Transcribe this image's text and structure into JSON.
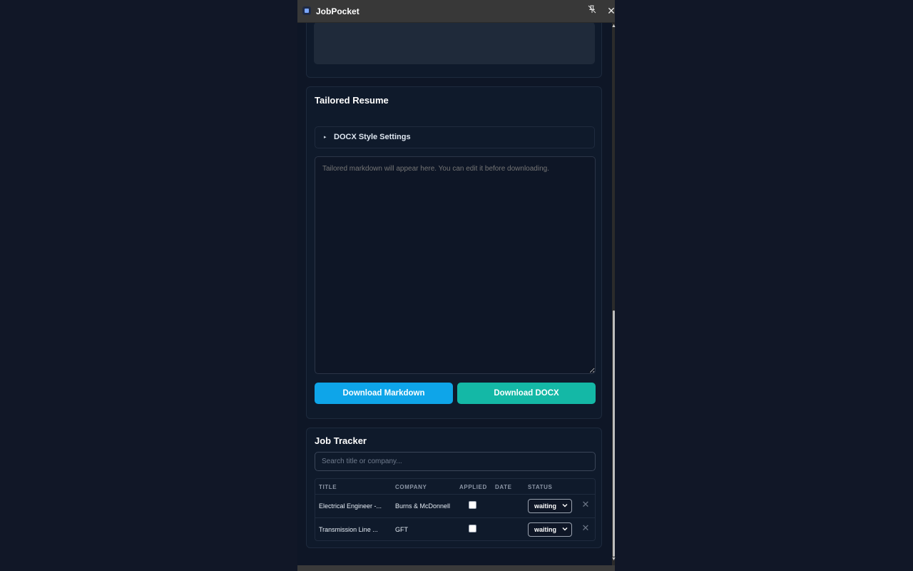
{
  "window": {
    "title": "JobPocket",
    "pin_icon": "pin-off-icon",
    "close_icon": "close-icon",
    "close_glyph": "✕",
    "scroll_up_glyph": "▲",
    "scroll_down_glyph": "▼"
  },
  "resume": {
    "title": "Tailored Resume",
    "docx_settings_label": "DOCX Style Settings",
    "docx_toggle_glyph": "▸",
    "markdown_placeholder": "Tailored markdown will appear here. You can edit it before downloading.",
    "download_markdown": "Download Markdown",
    "download_docx": "Download DOCX"
  },
  "tracker": {
    "title": "Job Tracker",
    "search_placeholder": "Search title or company...",
    "columns": {
      "title": "TITLE",
      "company": "COMPANY",
      "applied": "APPLIED",
      "date": "DATE",
      "status": "STATUS"
    },
    "rows": [
      {
        "title": "Electrical Engineer -...",
        "company": "Burns & McDonnell",
        "applied": false,
        "date": "",
        "status": "waiting"
      },
      {
        "title": "Transmission Line ...",
        "company": "GFT",
        "applied": false,
        "date": "",
        "status": "waiting"
      }
    ],
    "chevron_glyph": "⌄",
    "delete_glyph": "✕"
  },
  "colors": {
    "primary_button": "#0ea5e9",
    "secondary_button": "#14b8a6",
    "background": "#111727"
  }
}
